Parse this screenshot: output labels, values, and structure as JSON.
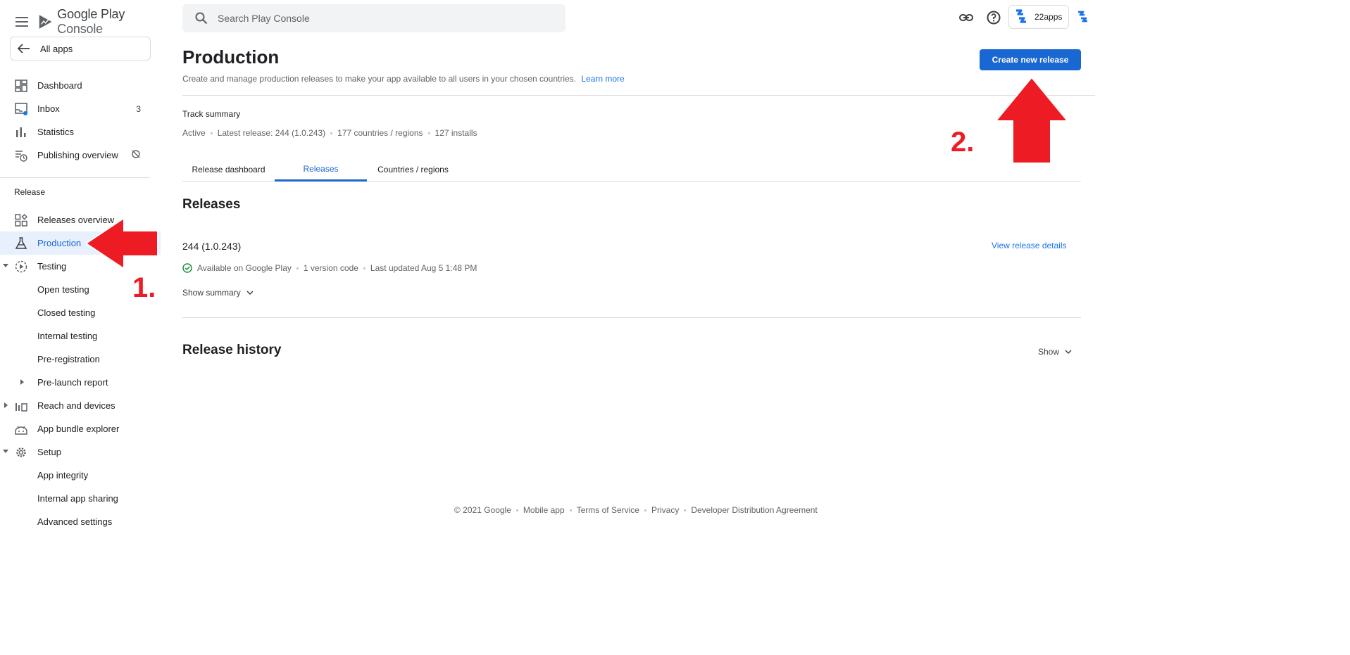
{
  "brand": {
    "google": "Google Play",
    "console": "Console"
  },
  "sidebar": {
    "all_apps": "All apps",
    "items_top": [
      {
        "label": "Dashboard"
      },
      {
        "label": "Inbox",
        "badge": "3"
      },
      {
        "label": "Statistics"
      },
      {
        "label": "Publishing overview"
      }
    ],
    "section_release": "Release",
    "items_release": [
      {
        "label": "Releases overview"
      },
      {
        "label": "Production"
      },
      {
        "label": "Testing"
      },
      {
        "label": "Open testing"
      },
      {
        "label": "Closed testing"
      },
      {
        "label": "Internal testing"
      },
      {
        "label": "Pre-registration"
      },
      {
        "label": "Pre-launch report"
      },
      {
        "label": "Reach and devices"
      },
      {
        "label": "App bundle explorer"
      },
      {
        "label": "Setup"
      },
      {
        "label": "App integrity"
      },
      {
        "label": "Internal app sharing"
      },
      {
        "label": "Advanced settings"
      }
    ]
  },
  "header": {
    "search_placeholder": "Search Play Console",
    "account_name": "22apps"
  },
  "page": {
    "title": "Production",
    "description": "Create and manage production releases to make your app available to all users in your chosen countries.",
    "learn_more": "Learn more",
    "create_button": "Create new release"
  },
  "track": {
    "title": "Track summary",
    "status": "Active",
    "latest_release": "Latest release: 244 (1.0.243)",
    "countries": "177 countries / regions",
    "installs": "127 installs"
  },
  "tabs": [
    {
      "label": "Release dashboard"
    },
    {
      "label": "Releases"
    },
    {
      "label": "Countries / regions"
    }
  ],
  "releases": {
    "heading": "Releases",
    "name": "244 (1.0.243)",
    "view_details": "View release details",
    "availability": "Available on Google Play",
    "version_codes": "1 version code",
    "last_updated": "Last updated Aug 5 1:48 PM",
    "show_summary": "Show summary"
  },
  "history": {
    "heading": "Release history",
    "show": "Show"
  },
  "footer": {
    "copyright": "© 2021 Google",
    "mobile_app": "Mobile app",
    "terms": "Terms of Service",
    "privacy": "Privacy",
    "dda": "Developer Distribution Agreement"
  },
  "annotations": {
    "step1": "1.",
    "step2": "2."
  },
  "colors": {
    "accent": "#1967d2",
    "link": "#1a73e8",
    "annotation": "#ed1c24",
    "active_bg": "#e8f0fe"
  }
}
